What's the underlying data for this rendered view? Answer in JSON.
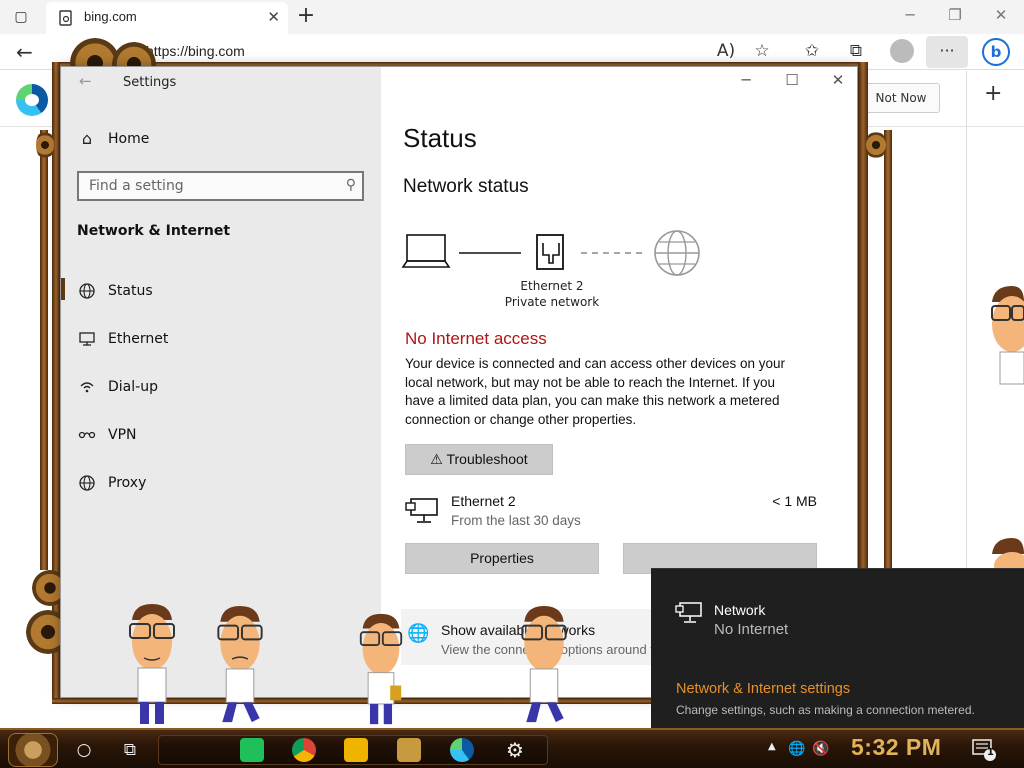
{
  "browser": {
    "tab_title": "bing.com",
    "url": "https://bing.com",
    "not_now_label": "Not Now"
  },
  "settings": {
    "window_title": "Settings",
    "home_label": "Home",
    "search_placeholder": "Find a setting",
    "section_title": "Network & Internet",
    "nav_items": [
      {
        "label": "Status",
        "icon": "globe-icon"
      },
      {
        "label": "Ethernet",
        "icon": "monitor-icon"
      },
      {
        "label": "Dial-up",
        "icon": "dialup-icon"
      },
      {
        "label": "VPN",
        "icon": "vpn-icon"
      },
      {
        "label": "Proxy",
        "icon": "globe-icon"
      }
    ],
    "page_title": "Status",
    "network_status_heading": "Network status",
    "adapter_name": "Ethernet 2",
    "network_profile": "Private network",
    "no_internet_heading": "No Internet access",
    "description": "Your device is connected and can access other devices on your local network, but may not be able to reach the Internet. If you have a limited data plan, you can make this network a metered connection or change other properties.",
    "troubleshoot_label": "Troubleshoot",
    "ethernet_name": "Ethernet 2",
    "ethernet_period": "From the last 30 days",
    "ethernet_usage": "< 1 MB",
    "properties_label": "Properties",
    "show_available_title": "Show available networks",
    "show_available_sub": "View the connection options around you."
  },
  "flyout": {
    "network_label": "Network",
    "network_status": "No Internet",
    "settings_link": "Network & Internet settings",
    "settings_sub": "Change settings, such as making a connection metered."
  },
  "taskbar": {
    "time": "5:32 PM",
    "notification_count": "1"
  },
  "colors": {
    "error": "#b01414",
    "link_orange": "#e8902a",
    "clock": "#e0b35a",
    "taskbar": "#2a1608"
  }
}
